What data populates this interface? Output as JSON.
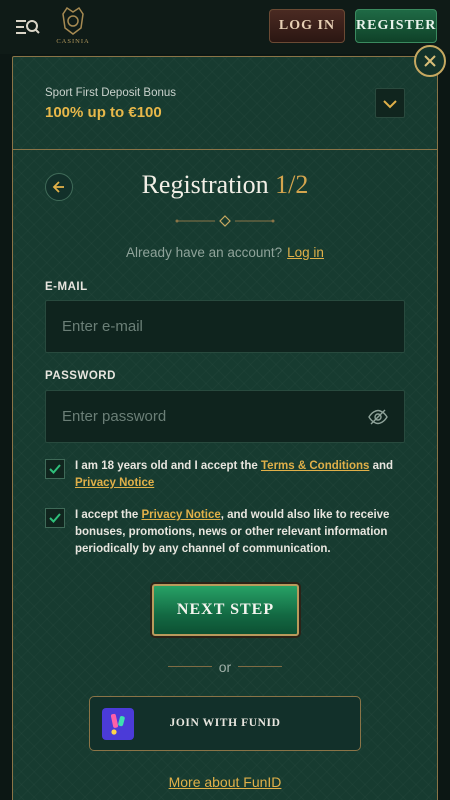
{
  "header": {
    "logo_text": "CASINIA",
    "login_label": "LOG IN",
    "register_label": "REGISTER"
  },
  "bonus": {
    "label": "Sport First Deposit Bonus",
    "amount": "100% up to €100"
  },
  "registration": {
    "title": "Registration",
    "step": "1/2",
    "already_text": "Already have an account?",
    "login_link": "Log in"
  },
  "form": {
    "email_label": "E-MAIL",
    "email_placeholder": "Enter e-mail",
    "email_value": "",
    "password_label": "PASSWORD",
    "password_placeholder": "Enter password",
    "password_value": ""
  },
  "consents": {
    "age": {
      "checked": true,
      "text_before": "I am 18 years old and I accept the ",
      "terms_link": "Terms & Conditions",
      "text_and": " and",
      "privacy_link": "Privacy Notice"
    },
    "marketing": {
      "checked": true,
      "text_before": "I accept the ",
      "privacy_link": "Privacy Notice",
      "text_after": ", and would also like to receive bonuses, promotions, news or other relevant information periodically by any channel of communication."
    }
  },
  "actions": {
    "next_step_label": "NEXT STEP",
    "or_text": "or",
    "funid_label": "JOIN WITH FUNID",
    "more_funid_link": "More about FunID"
  },
  "colors": {
    "accent_gold": "#e0b049",
    "panel_green": "#173b30",
    "button_green": "#1f8a55"
  },
  "icons": [
    "menu-search-icon",
    "logo-crest-icon",
    "close-icon",
    "chevron-down-icon",
    "arrow-left-icon",
    "eye-off-icon",
    "check-icon",
    "funid-logo-icon"
  ]
}
